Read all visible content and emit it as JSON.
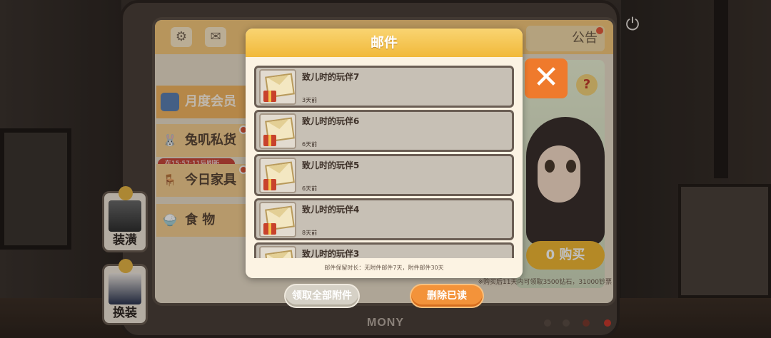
{
  "monitor": {
    "brand": "MONY"
  },
  "screen": {
    "top_bar": {
      "notice_tab": "公告"
    },
    "menu": [
      {
        "label": "月度会员"
      },
      {
        "label": "兔叽私货"
      },
      {
        "label": "今日家具"
      },
      {
        "label": "食 物"
      }
    ],
    "timer_tag": "在15:57:11后刷新",
    "buy_button": "0 购买",
    "buy_note": "※购买后11天内可领取3500钻石，31000钞票"
  },
  "side_actions": [
    {
      "label": "装潢"
    },
    {
      "label": "换装"
    }
  ],
  "mail": {
    "title": "邮件",
    "items": [
      {
        "title": "致儿时的玩伴7",
        "time": "3天前"
      },
      {
        "title": "致儿时的玩伴6",
        "time": "6天前"
      },
      {
        "title": "致儿时的玩伴5",
        "time": "6天前"
      },
      {
        "title": "致儿时的玩伴4",
        "time": "8天前"
      },
      {
        "title": "致儿时的玩伴3",
        "time": ""
      }
    ],
    "retention_note": "邮件保留时长：无附件邮件7天，附件邮件30天",
    "claim_all_label": "领取全部附件",
    "delete_read_label": "删除已读"
  },
  "colors": {
    "header_gold": "#f1b93a",
    "close_orange": "#ef7a2c",
    "delete_orange": "#f3933a",
    "claim_gray": "#d6d1c6"
  },
  "icons": {
    "close": "close-x-icon",
    "power": "power-icon",
    "settings": "gear-icon",
    "mail": "envelope-icon",
    "help": "question-icon"
  }
}
